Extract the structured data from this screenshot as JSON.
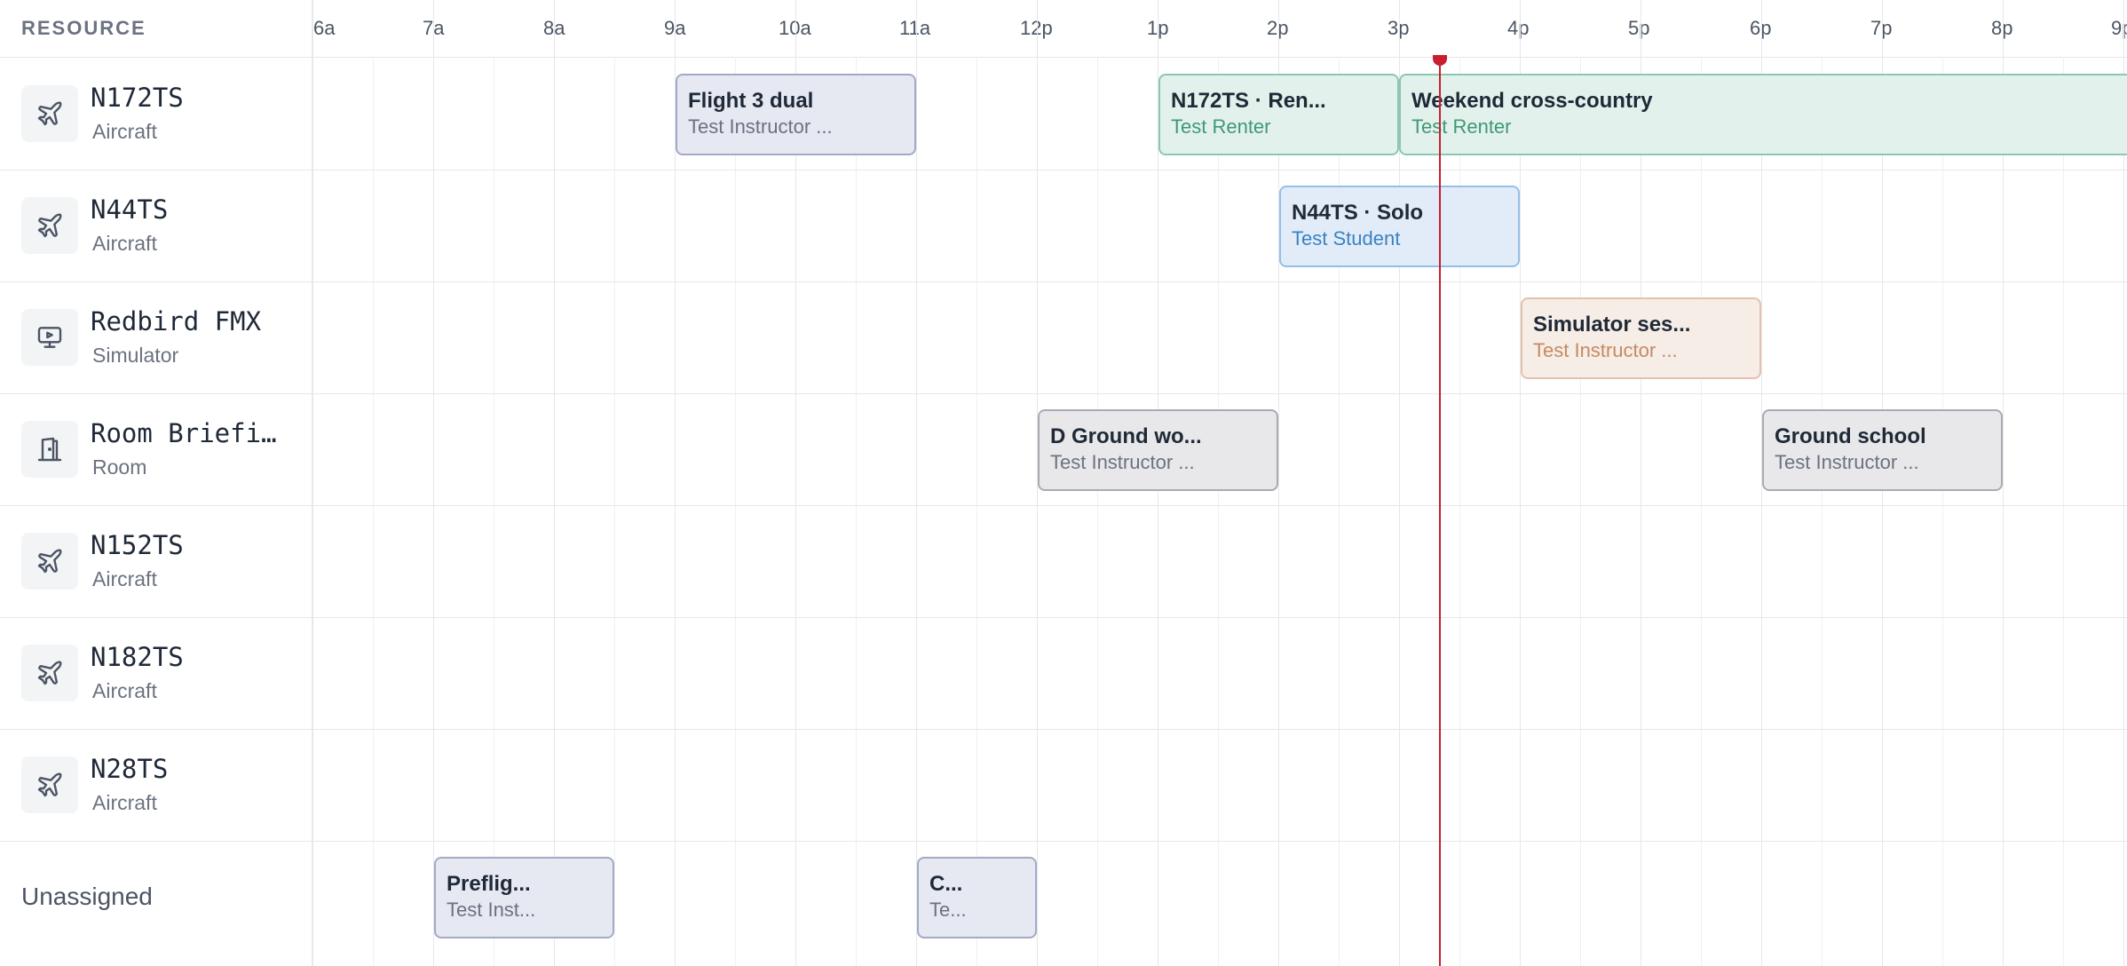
{
  "header": {
    "resource_label": "RESOURCE",
    "hours": [
      "6a",
      "7a",
      "8a",
      "9a",
      "10a",
      "11a",
      "12p",
      "1p",
      "2p",
      "3p",
      "4p",
      "5p",
      "6p",
      "7p",
      "8p",
      "9p"
    ]
  },
  "resources": [
    {
      "name": "N172TS",
      "type": "Aircraft",
      "icon": "airplane-icon"
    },
    {
      "name": "N44TS",
      "type": "Aircraft",
      "icon": "airplane-icon"
    },
    {
      "name": "Redbird FMX",
      "type": "Simulator",
      "icon": "simulator-icon"
    },
    {
      "name": "Room Briefin…",
      "type": "Room",
      "icon": "door-icon"
    },
    {
      "name": "N152TS",
      "type": "Aircraft",
      "icon": "airplane-icon"
    },
    {
      "name": "N182TS",
      "type": "Aircraft",
      "icon": "airplane-icon"
    },
    {
      "name": "N28TS",
      "type": "Aircraft",
      "icon": "airplane-icon"
    }
  ],
  "unassigned": {
    "label": "Unassigned"
  },
  "events": [
    {
      "title": "Flight 3 dual",
      "subtitle": "Test Instructor ...",
      "color": "indigo"
    },
    {
      "title": "N172TS · Ren...",
      "subtitle": "Test Renter",
      "color": "green"
    },
    {
      "title": "Weekend cross-country",
      "subtitle": "Test Renter",
      "color": "green"
    },
    {
      "title": "N44TS · Solo",
      "subtitle": "Test Student",
      "color": "blue"
    },
    {
      "title": "Simulator ses...",
      "subtitle": "Test Instructor ...",
      "color": "tan"
    },
    {
      "title": "D Ground wo...",
      "subtitle": "Test Instructor ...",
      "color": "grey"
    },
    {
      "title": "Ground school",
      "subtitle": "Test Instructor ...",
      "color": "grey"
    },
    {
      "title": "Preflig...",
      "subtitle": "Test Inst...",
      "color": "indigo"
    },
    {
      "title": "C...",
      "subtitle": "Te...",
      "color": "indigo"
    }
  ],
  "colors": {
    "now_indicator": "#c81e2e",
    "green_subtitle": "#3d9a75",
    "blue_subtitle": "#3b82c4",
    "tan_subtitle": "#c58a63"
  }
}
